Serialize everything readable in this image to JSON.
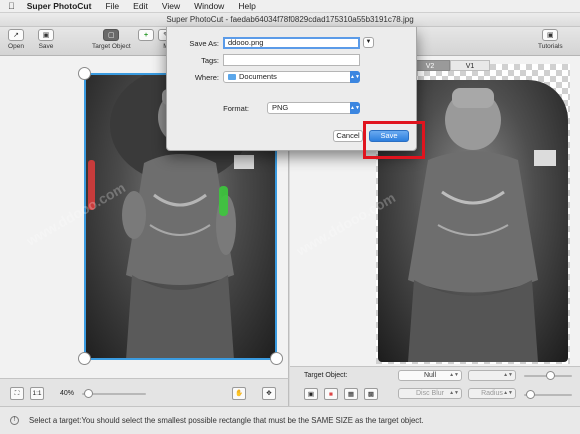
{
  "menubar": {
    "app_name": "Super PhotoCut",
    "items": [
      "File",
      "Edit",
      "View",
      "Window",
      "Help"
    ]
  },
  "window": {
    "title": "Super PhotoCut - faedab64034f78f0829cdad175310a55b3191c78.jpg"
  },
  "toolbar": {
    "open": "Open",
    "save": "Save",
    "target_object": "Target Object",
    "partial_label": "M",
    "tutorials": "Tutorials"
  },
  "left_bottom": {
    "fit_label": "1:1",
    "zoom": "40%"
  },
  "right_panel": {
    "tabs": [
      "V2",
      "V1"
    ],
    "target_object_label": "Target Object:",
    "null_select": "Null",
    "disc_blur": "Disc Blur",
    "radius": "Radius"
  },
  "save_dialog": {
    "save_as_label": "Save As:",
    "save_as_value": "ddooo.png",
    "tags_label": "Tags:",
    "tags_value": "",
    "where_label": "Where:",
    "where_value": "Documents",
    "format_label": "Format:",
    "format_value": "PNG",
    "cancel": "Cancel",
    "save": "Save"
  },
  "statusbar": {
    "text": "Select a target:You should select the smallest possible rectangle that must be the SAME SIZE as the target object."
  },
  "colors": {
    "accent_blue": "#2d7fde",
    "highlight_red": "#e0141e",
    "keep_green": "#3cc83c",
    "remove_red": "#e13c3c"
  }
}
